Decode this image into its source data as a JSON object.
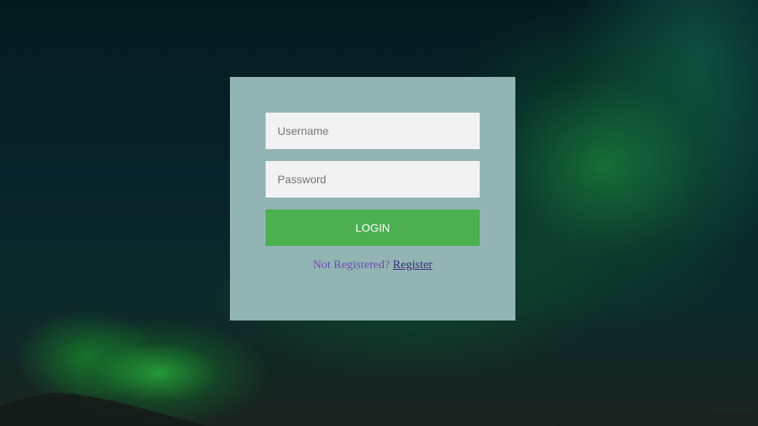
{
  "login_form": {
    "username_placeholder": "Username",
    "password_placeholder": "Password",
    "login_label": "LOGIN",
    "not_registered_text": "Not Registered?",
    "register_link_label": "Register"
  },
  "colors": {
    "panel_background": "#92b5b4",
    "input_background": "#f2f2f2",
    "button_background": "#4caf50",
    "button_text": "#ffffff",
    "message_text": "#6a4fb0",
    "link_text": "#3b2a7a"
  }
}
